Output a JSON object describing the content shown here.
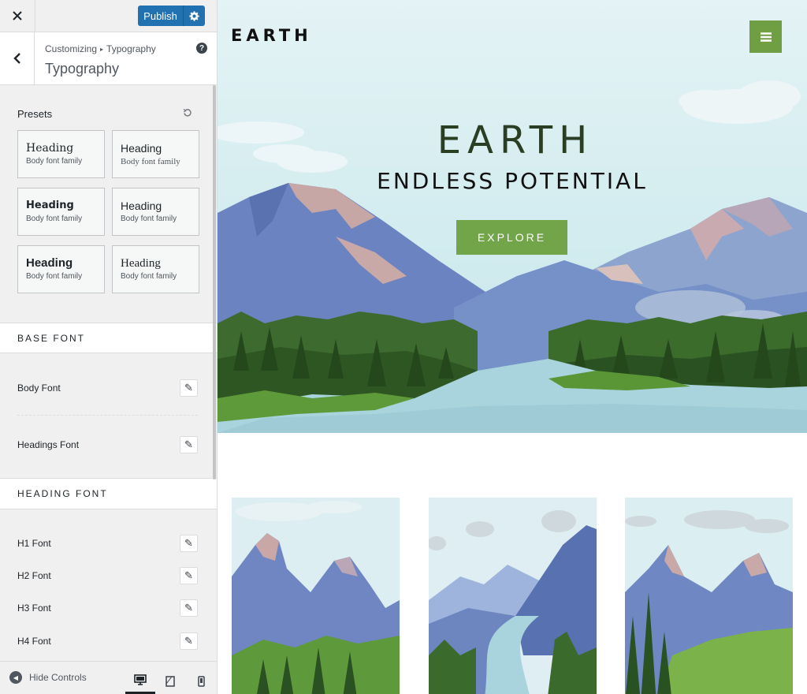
{
  "customizer": {
    "publish_label": "Publish",
    "breadcrumb_root": "Customizing",
    "breadcrumb_current": "Typography",
    "section_title": "Typography",
    "presets_label": "Presets",
    "presets": [
      {
        "heading": "Heading",
        "body": "Body font family"
      },
      {
        "heading": "Heading",
        "body": "Body font family"
      },
      {
        "heading": "Heading",
        "body": "Body font family"
      },
      {
        "heading": "Heading",
        "body": "Body font family"
      },
      {
        "heading": "Heading",
        "body": "Body font family"
      },
      {
        "heading": "Heading",
        "body": "Body font family"
      }
    ],
    "base_font_label": "BASE FONT",
    "body_font_label": "Body Font",
    "headings_font_label": "Headings Font",
    "heading_font_label": "HEADING FONT",
    "h1_label": "H1 Font",
    "h2_label": "H2 Font",
    "h3_label": "H3 Font",
    "h4_label": "H4 Font",
    "hide_controls_label": "Hide Controls",
    "accent_color": "#2271b1"
  },
  "preview": {
    "site_logo": "EARTH",
    "hero_title": "EARTH",
    "hero_subtitle": "ENDLESS POTENTIAL",
    "cta_label": "EXPLORE",
    "brand_green": "#72a54a"
  }
}
